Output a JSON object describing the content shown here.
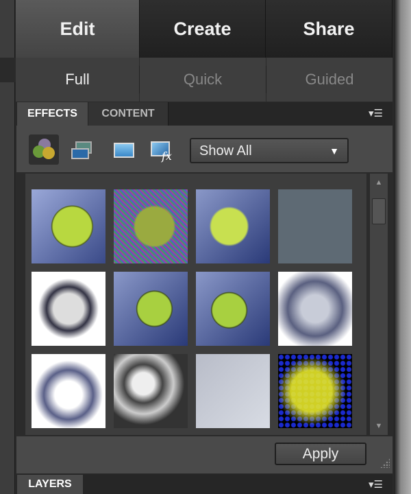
{
  "mode_tabs": [
    {
      "label": "Edit",
      "active": true
    },
    {
      "label": "Create"
    },
    {
      "label": "Share"
    }
  ],
  "edit_modes": [
    {
      "label": "Full",
      "active": true
    },
    {
      "label": "Quick"
    },
    {
      "label": "Guided"
    }
  ],
  "panel_tabs": [
    {
      "label": "EFFECTS",
      "active": true
    },
    {
      "label": "CONTENT"
    }
  ],
  "filter": {
    "selected": "Show All"
  },
  "icons": [
    "filters-icon",
    "layer-styles-icon",
    "photo-effects-icon",
    "all-effects-icon"
  ],
  "apply_label": "Apply",
  "layers_label": "LAYERS"
}
